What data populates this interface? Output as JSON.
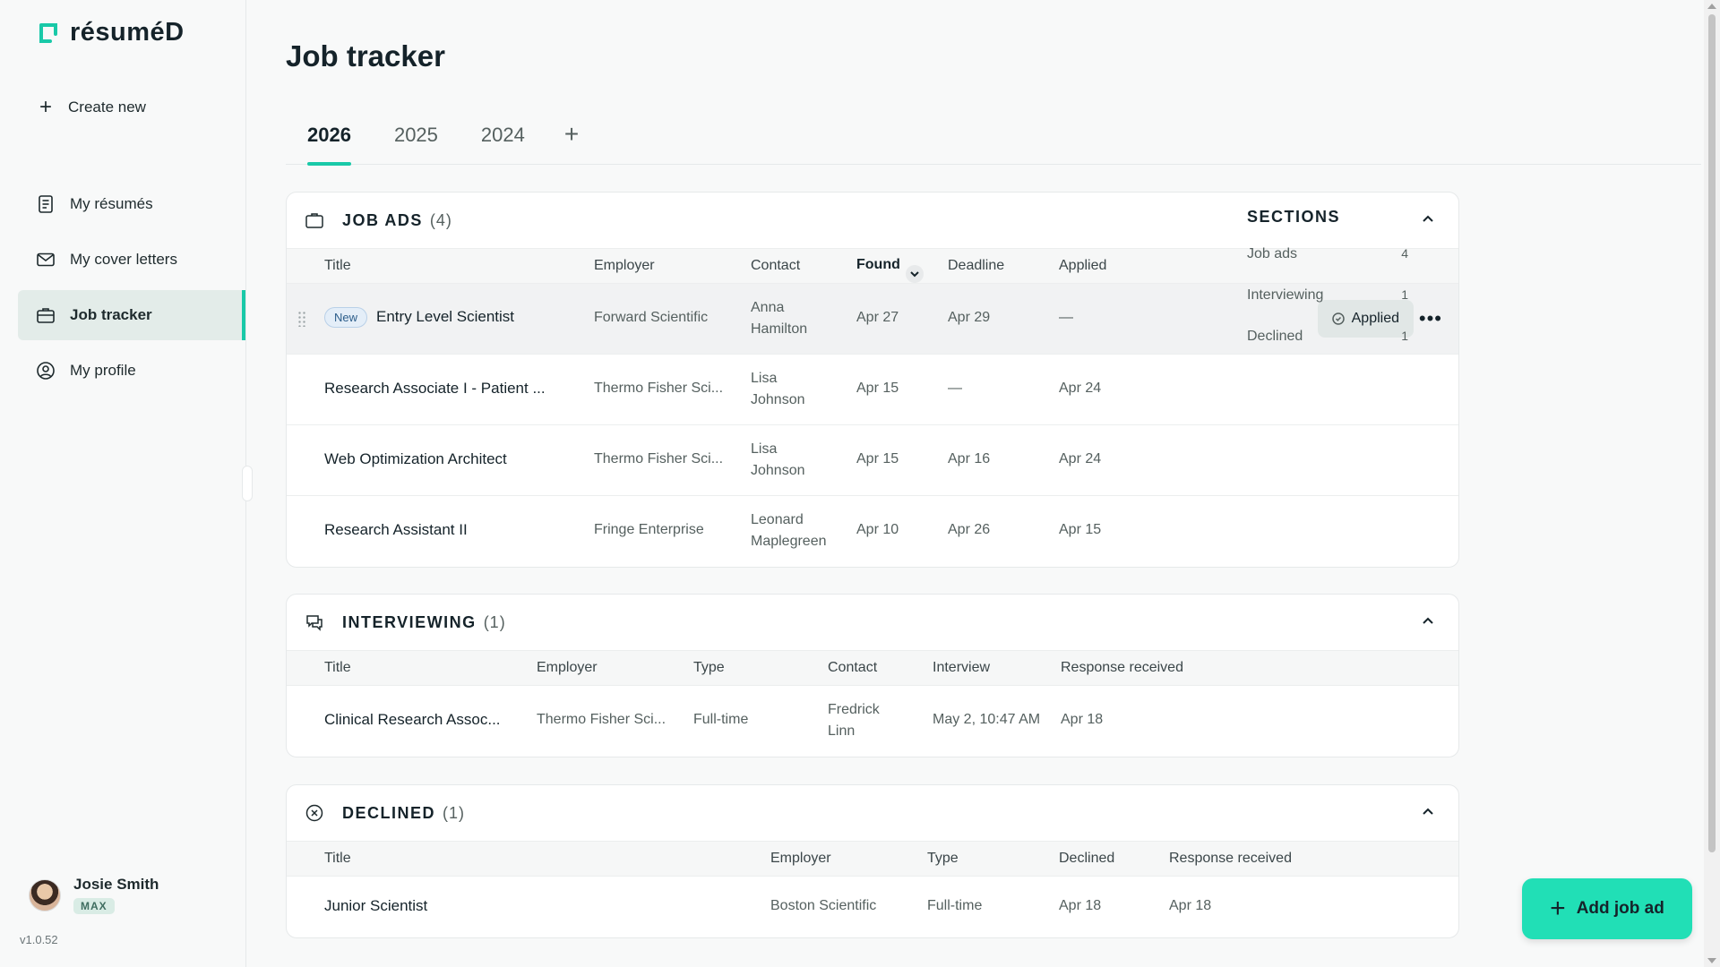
{
  "brand": {
    "name": "résuméD",
    "accent": "#19c9a8"
  },
  "sidebar": {
    "create_label": "Create new",
    "items": [
      {
        "label": "My résumés",
        "icon": "document-icon"
      },
      {
        "label": "My cover letters",
        "icon": "envelope-icon"
      },
      {
        "label": "Job tracker",
        "icon": "briefcase-icon",
        "active": true
      },
      {
        "label": "My profile",
        "icon": "user-circle-icon"
      }
    ],
    "user": {
      "name": "Josie Smith",
      "plan": "MAX"
    },
    "version": "v1.0.52"
  },
  "page": {
    "title": "Job tracker"
  },
  "tabs": {
    "items": [
      "2026",
      "2025",
      "2024"
    ],
    "active": "2026",
    "add": "+"
  },
  "job_ads": {
    "title": "JOB ADS",
    "count": "(4)",
    "columns": [
      "Title",
      "Employer",
      "Contact",
      "Found",
      "Deadline",
      "Applied"
    ],
    "rows": [
      {
        "badge": "New",
        "title": "Entry Level Scientist",
        "employer": "Forward Scientific",
        "contact1": "Anna",
        "contact2": "Hamilton",
        "found": "Apr 27",
        "deadline": "Apr 29",
        "applied": "—",
        "status": "Applied"
      },
      {
        "title": "Research Associate I - Patient ...",
        "employer": "Thermo Fisher Sci...",
        "contact1": "Lisa",
        "contact2": "Johnson",
        "found": "Apr 15",
        "deadline": "—",
        "applied": "Apr 24"
      },
      {
        "title": "Web Optimization Architect",
        "employer": "Thermo Fisher Sci...",
        "contact1": "Lisa",
        "contact2": "Johnson",
        "found": "Apr 15",
        "deadline": "Apr 16",
        "applied": "Apr 24"
      },
      {
        "title": "Research Assistant II",
        "employer": "Fringe Enterprise",
        "contact1": "Leonard",
        "contact2": "Maplegreen",
        "found": "Apr 10",
        "deadline": "Apr 26",
        "applied": "Apr 15"
      }
    ]
  },
  "interviewing": {
    "title": "INTERVIEWING",
    "count": "(1)",
    "columns": [
      "Title",
      "Employer",
      "Type",
      "Contact",
      "Interview",
      "Response received"
    ],
    "rows": [
      {
        "title": "Clinical Research Assoc...",
        "employer": "Thermo Fisher Sci...",
        "type": "Full-time",
        "contact1": "Fredrick",
        "contact2": "Linn",
        "interview": "May 2, 10:47 AM",
        "response": "Apr 18"
      }
    ]
  },
  "declined": {
    "title": "DECLINED",
    "count": "(1)",
    "columns": [
      "Title",
      "Employer",
      "Type",
      "Declined",
      "Response received"
    ],
    "rows": [
      {
        "title": "Junior Scientist",
        "employer": "Boston Scientific",
        "type": "Full-time",
        "declined": "Apr 18",
        "response": "Apr 18"
      }
    ]
  },
  "sections_panel": {
    "title": "SECTIONS",
    "items": [
      {
        "label": "Job ads",
        "count": "4"
      },
      {
        "label": "Interviewing",
        "count": "1"
      },
      {
        "label": "Declined",
        "count": "1"
      }
    ]
  },
  "add_button": {
    "label": "Add job ad"
  }
}
